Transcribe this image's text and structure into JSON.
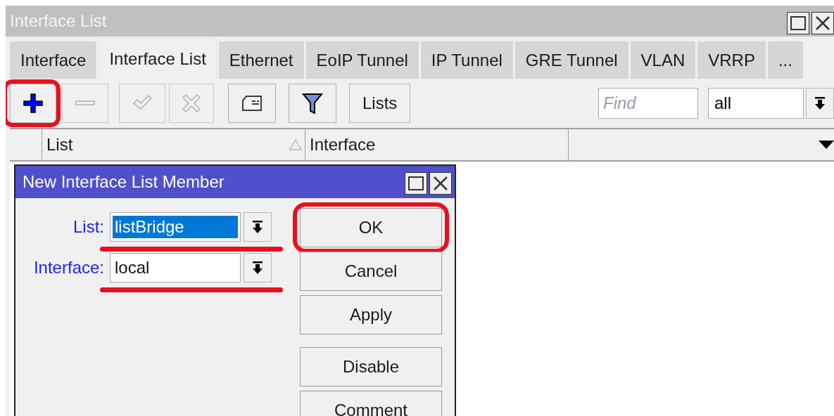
{
  "window": {
    "title": "Interface List"
  },
  "tabs": [
    {
      "label": "Interface",
      "selected": false
    },
    {
      "label": "Interface List",
      "selected": true
    },
    {
      "label": "Ethernet",
      "selected": false
    },
    {
      "label": "EoIP Tunnel",
      "selected": false
    },
    {
      "label": "IP Tunnel",
      "selected": false
    },
    {
      "label": "GRE Tunnel",
      "selected": false
    },
    {
      "label": "VLAN",
      "selected": false
    },
    {
      "label": "VRRP",
      "selected": false
    },
    {
      "label": "...",
      "selected": false
    }
  ],
  "toolbar": {
    "buttons": [
      {
        "kind": "add",
        "disabled": false
      },
      {
        "kind": "remove",
        "disabled": true
      },
      {
        "kind": "enable",
        "disabled": true
      },
      {
        "kind": "disable",
        "disabled": true
      },
      {
        "kind": "comment",
        "disabled": false
      },
      {
        "kind": "filter",
        "disabled": false
      },
      {
        "kind": "text",
        "label": "Lists"
      }
    ],
    "find": {
      "placeholder": "Find"
    },
    "filter": {
      "value": "all"
    }
  },
  "table": {
    "columns": [
      {
        "label": "List",
        "sorted": true
      },
      {
        "label": "Interface",
        "sorted": false
      }
    ]
  },
  "dialog": {
    "title": "New Interface List Member",
    "fields": [
      {
        "label": "List:",
        "value": "listBridge",
        "text_selected": true
      },
      {
        "label": "Interface:",
        "value": "local",
        "text_selected": false
      }
    ],
    "buttons": [
      "OK",
      "Cancel",
      "Apply",
      "Disable",
      "Comment"
    ]
  }
}
